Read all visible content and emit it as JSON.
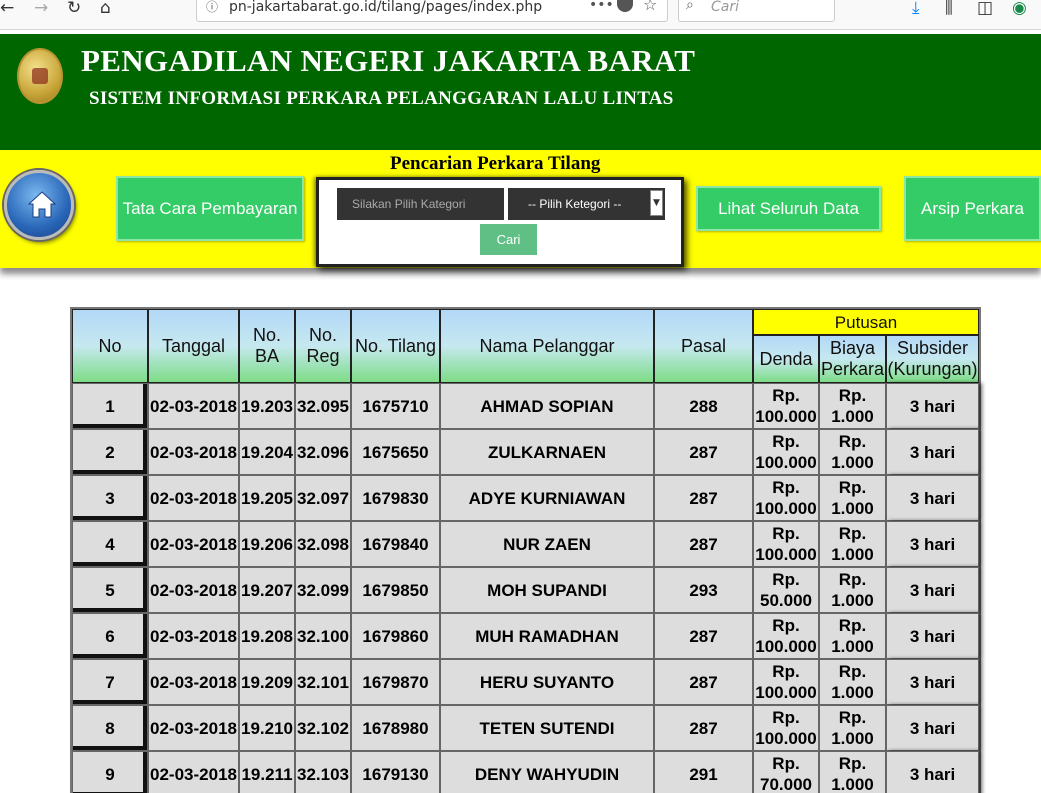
{
  "browser": {
    "url": "pn-jakartabarat.go.id/tilang/pages/index.php",
    "search_placeholder": "Cari",
    "dots": "•••"
  },
  "header": {
    "title": "PENGADILAN NEGERI JAKARTA BARAT",
    "subtitle": "SISTEM INFORMASI PERKARA PELANGGARAN LALU LINTAS"
  },
  "nav": {
    "tata_cara": "Tata Cara Pembayaran",
    "search_title": "Pencarian Perkara Tilang",
    "category_placeholder": "Silakan Pilih Kategori",
    "category_select": "-- Pilih Ketegori --",
    "cari": "Cari",
    "lihat": "Lihat Seluruh Data",
    "arsip": "Arsip Perkara"
  },
  "table": {
    "headers": {
      "no": "No",
      "tanggal": "Tanggal",
      "no_ba": "No. BA",
      "no_reg": "No. Reg",
      "no_tilang": "No. Tilang",
      "nama": "Nama Pelanggar",
      "pasal": "Pasal",
      "putusan": "Putusan",
      "denda": "Denda",
      "biaya": "Biaya Perkara",
      "subsider": "Subsider (Kurungan)"
    },
    "rows": [
      [
        "1",
        "02-03-2018",
        "19.203",
        "32.095",
        "1675710",
        "AHMAD SOPIAN",
        "288",
        "Rp. 100.000",
        "Rp. 1.000",
        "3 hari"
      ],
      [
        "2",
        "02-03-2018",
        "19.204",
        "32.096",
        "1675650",
        "ZULKARNAEN",
        "287",
        "Rp. 100.000",
        "Rp. 1.000",
        "3 hari"
      ],
      [
        "3",
        "02-03-2018",
        "19.205",
        "32.097",
        "1679830",
        "ADYE KURNIAWAN",
        "287",
        "Rp. 100.000",
        "Rp. 1.000",
        "3 hari"
      ],
      [
        "4",
        "02-03-2018",
        "19.206",
        "32.098",
        "1679840",
        "NUR ZAEN",
        "287",
        "Rp. 100.000",
        "Rp. 1.000",
        "3 hari"
      ],
      [
        "5",
        "02-03-2018",
        "19.207",
        "32.099",
        "1679850",
        "MOH SUPANDI",
        "293",
        "Rp. 50.000",
        "Rp. 1.000",
        "3 hari"
      ],
      [
        "6",
        "02-03-2018",
        "19.208",
        "32.100",
        "1679860",
        "MUH RAMADHAN",
        "287",
        "Rp. 100.000",
        "Rp. 1.000",
        "3 hari"
      ],
      [
        "7",
        "02-03-2018",
        "19.209",
        "32.101",
        "1679870",
        "HERU SUYANTO",
        "287",
        "Rp. 100.000",
        "Rp. 1.000",
        "3 hari"
      ],
      [
        "8",
        "02-03-2018",
        "19.210",
        "32.102",
        "1678980",
        "TETEN SUTENDI",
        "287",
        "Rp. 100.000",
        "Rp. 1.000",
        "3 hari"
      ],
      [
        "9",
        "02-03-2018",
        "19.211",
        "32.103",
        "1679130",
        "DENY WAHYUDIN",
        "291",
        "Rp. 70.000",
        "Rp. 1.000",
        "3 hari"
      ]
    ]
  }
}
